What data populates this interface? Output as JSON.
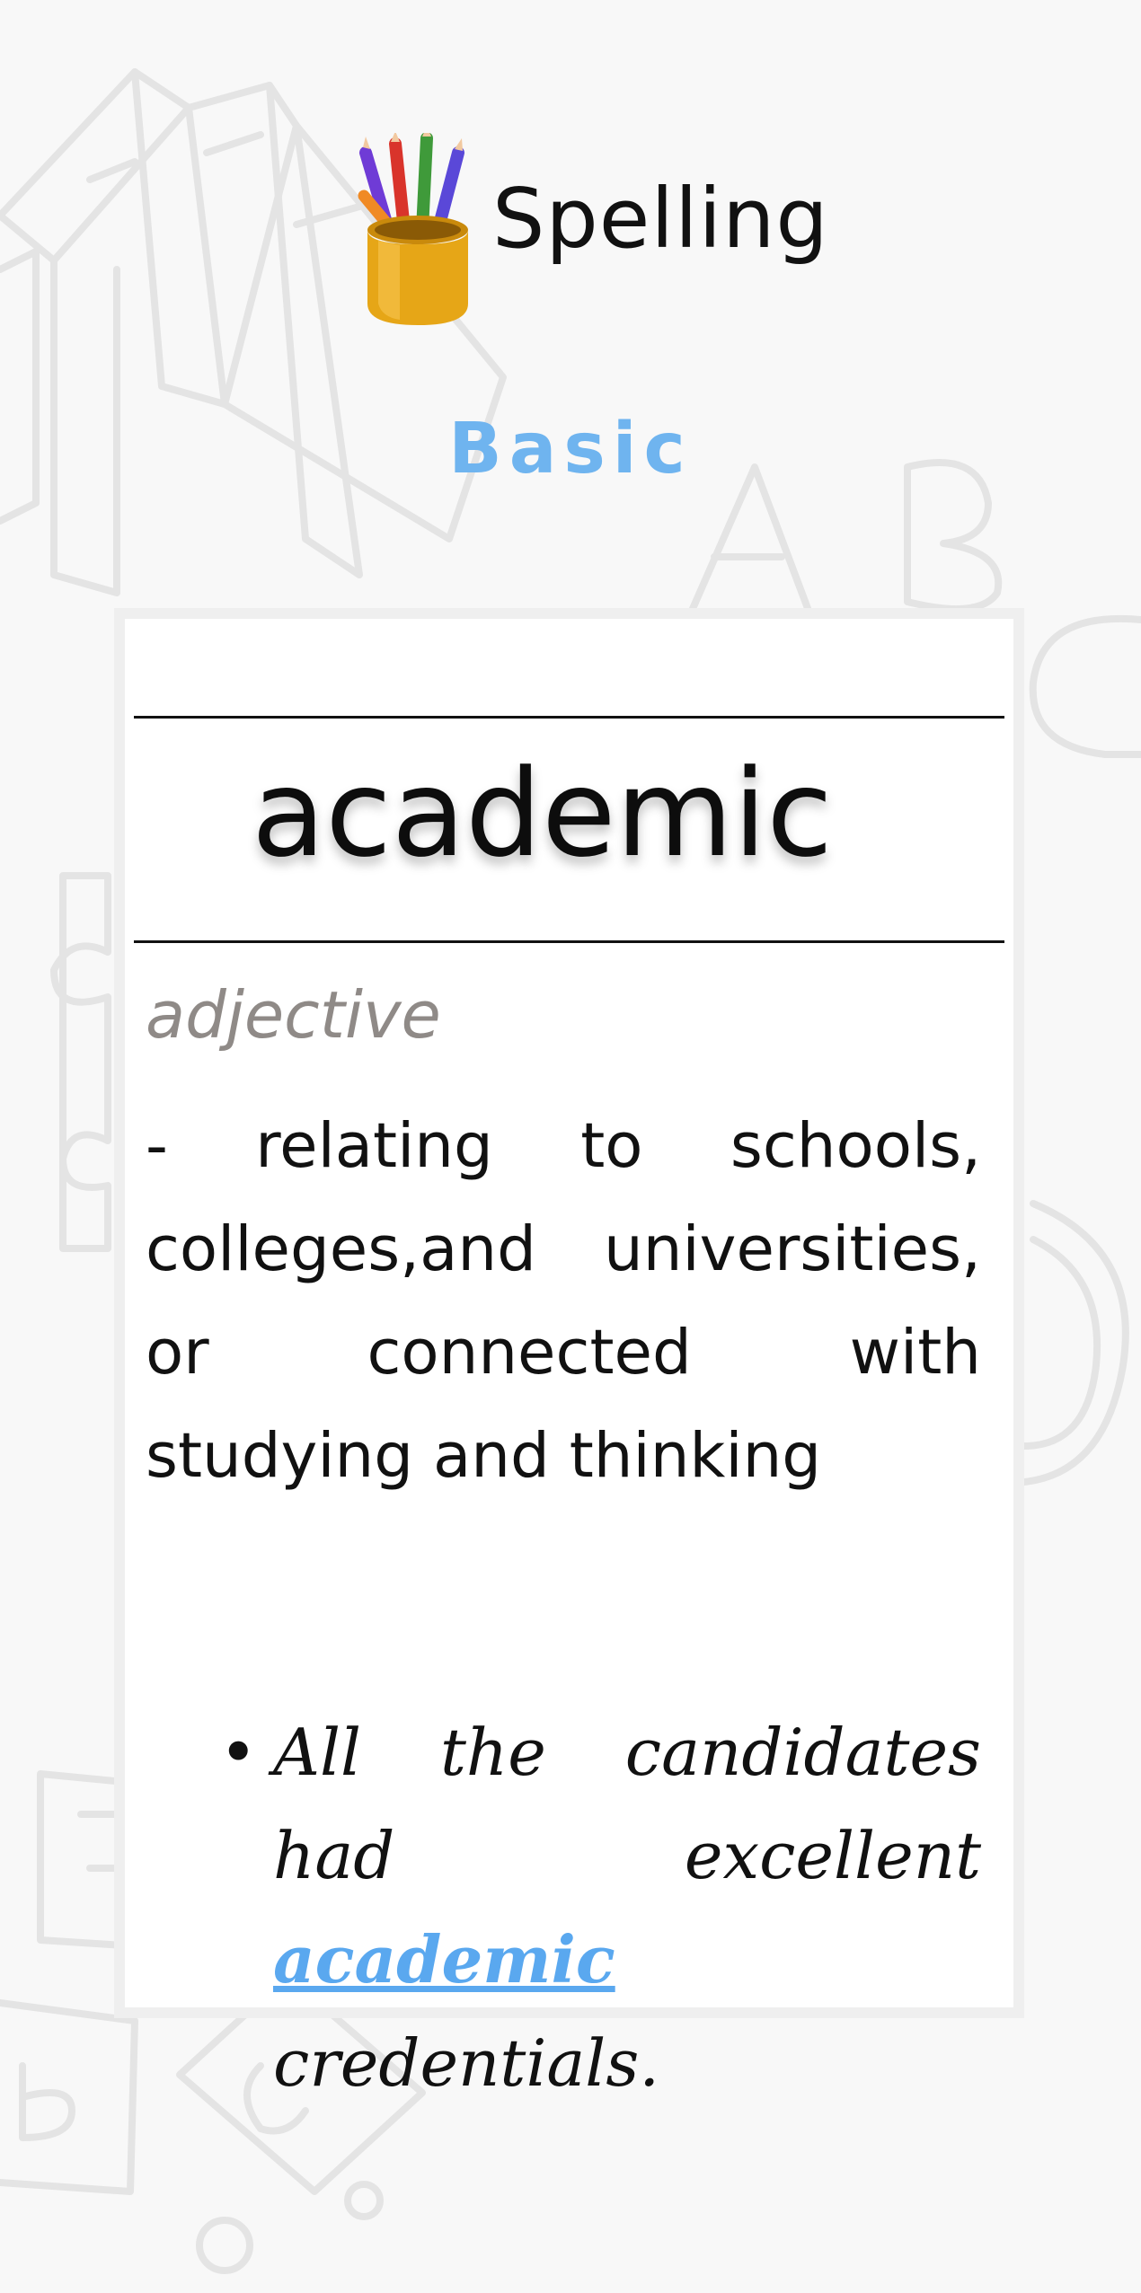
{
  "header": {
    "title": "Spelling",
    "level": "Basic"
  },
  "card": {
    "word": "academic",
    "part_of_speech": "adjective",
    "definition": " - relating to schools, colleges,and universities, or connected with studying and thinking",
    "example": {
      "before": "All the candidates had excellent ",
      "highlight": "academic",
      "after": " credentials."
    }
  },
  "colors": {
    "accent": "#6fb4ef",
    "highlight": "#5aa8ef",
    "pos_text": "#8f8a87",
    "background": "#f8f8f8"
  },
  "icons": {
    "logo": "pencil-cup-icon"
  }
}
